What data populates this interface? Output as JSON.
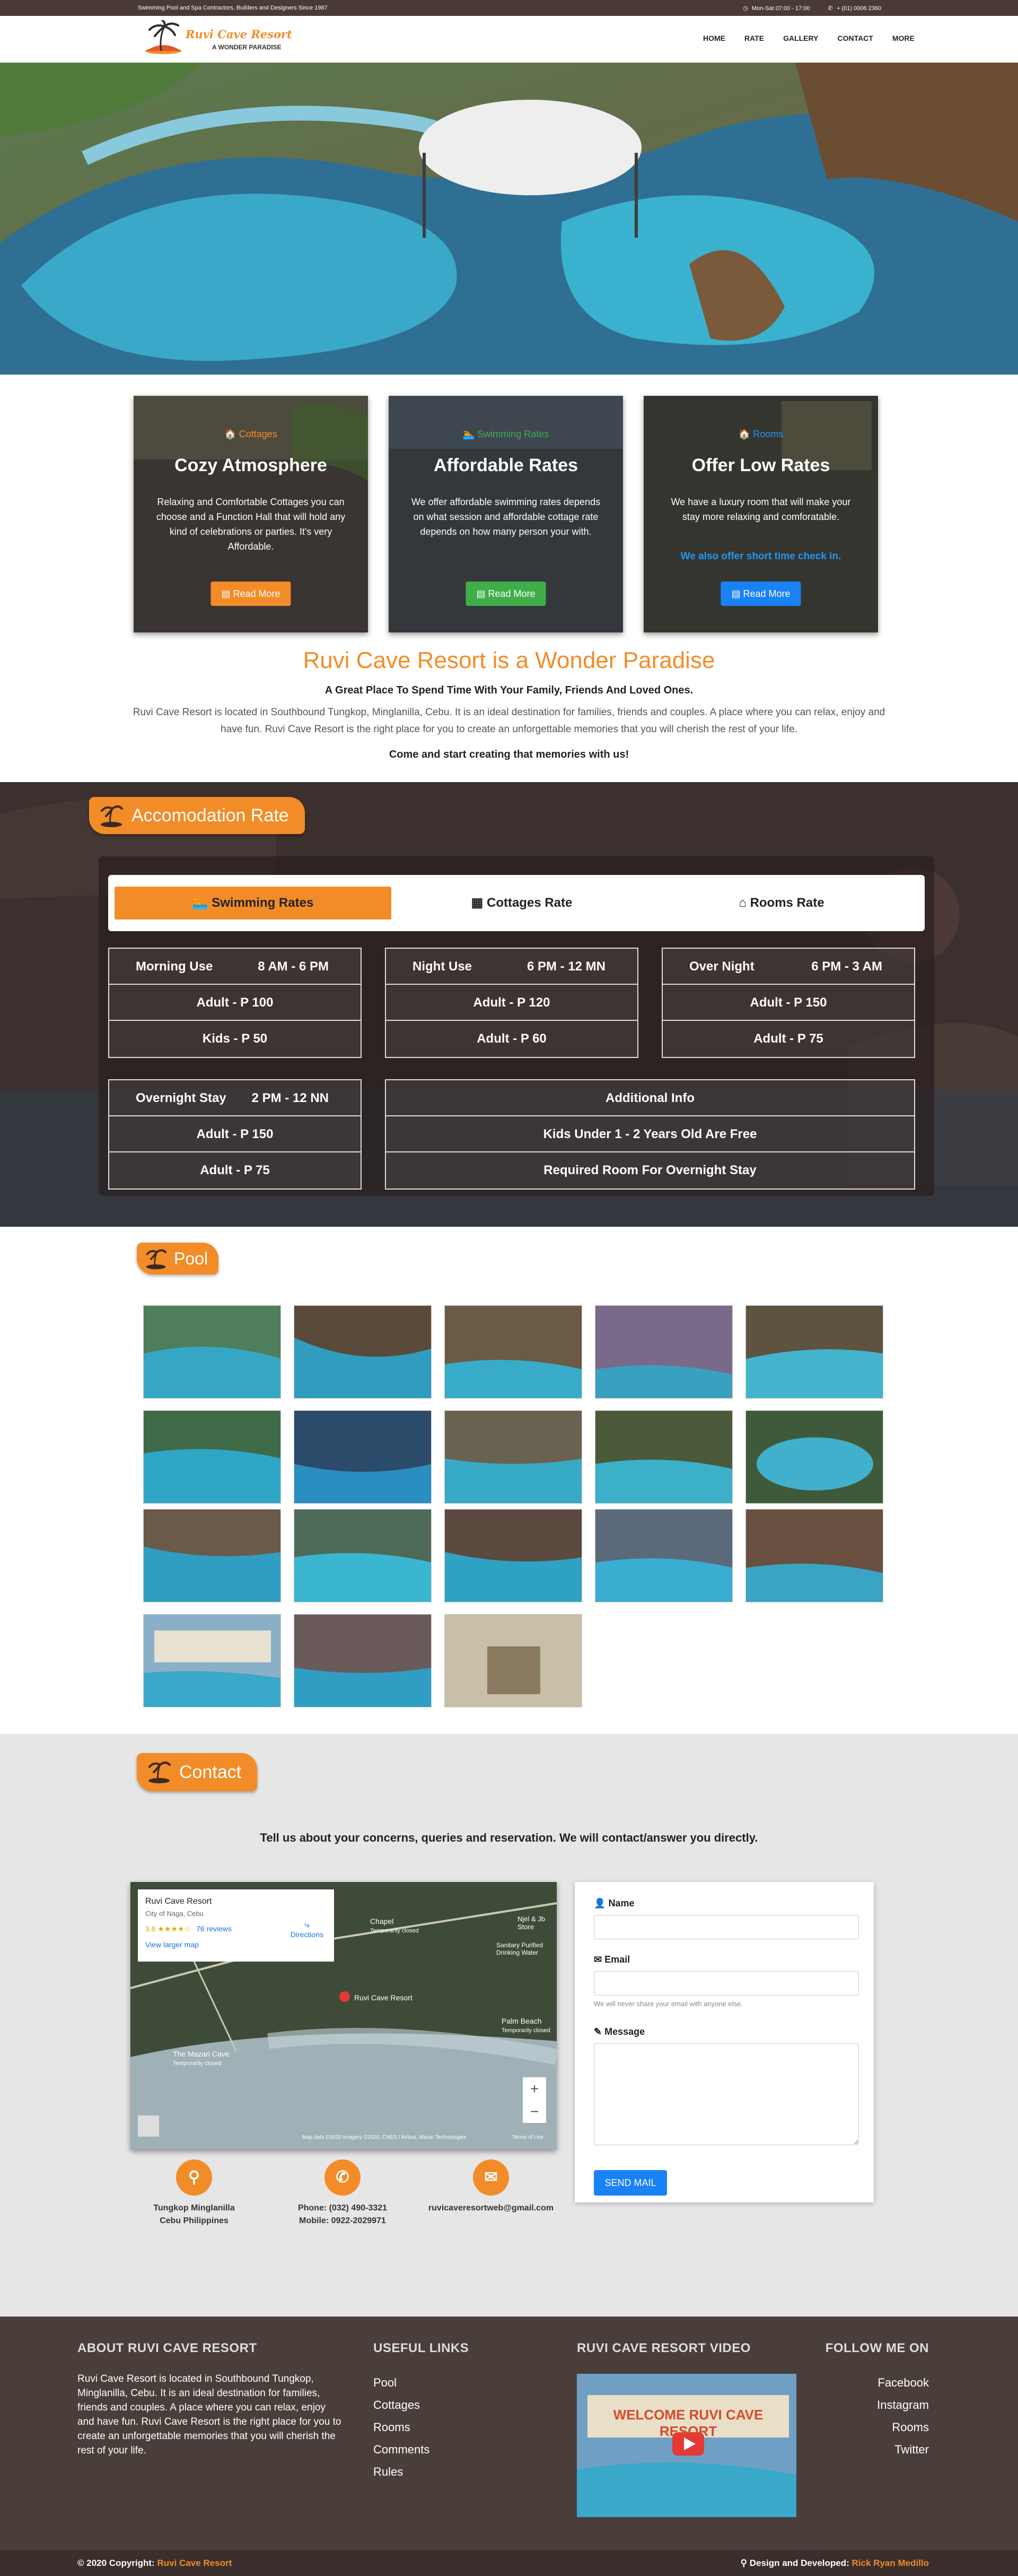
{
  "topbar": {
    "tagline": "Swimming Pool and Spa Contractors, Builders and Designers Since 1987",
    "hours": "Mon-Sat 07:00 - 17:00",
    "phone": "+ (01) 0006 2360"
  },
  "brand": {
    "name": "Ruvi Cave Resort",
    "slogan": "A WONDER PARADISE"
  },
  "nav": [
    "HOME",
    "RATE",
    "GALLERY",
    "CONTACT",
    "MORE"
  ],
  "cards": [
    {
      "category": "Cottages",
      "title": "Cozy Atmosphere",
      "text": "Relaxing and Comfortable Cottages you can choose and a Function Hall that will hold any kind of celebrations or parties. It's very Affordable.",
      "extra": "",
      "button": "Read More",
      "color": "#f28c28",
      "btn_color": "#f28c28"
    },
    {
      "category": "Swimming Rates",
      "title": "Affordable Rates",
      "text": "We offer affordable swimming rates depends on what session and affordable cottage rate depends on how many person your with.",
      "extra": "",
      "button": "Read More",
      "color": "#3fae49",
      "btn_color": "#3fae49"
    },
    {
      "category": "Rooms",
      "title": "Offer Low Rates",
      "text": "We have a luxury room that will make your stay more relaxing and comforatable.",
      "extra": "We also offer short time check in.",
      "button": "Read More",
      "color": "#2196f3",
      "btn_color": "#1a82f7"
    }
  ],
  "welcome": {
    "heading": "Ruvi Cave Resort is a Wonder Paradise",
    "subheading": "A Great Place To Spend Time With Your Family, Friends And Loved Ones.",
    "paragraph": "Ruvi Cave Resort is located in Southbound Tungkop, Minglanilla, Cebu. It is an ideal destination for families, friends and couples. A place where you can relax, enjoy and have fun. Ruvi Cave Resort is the right place for you to create an unforgettable memories that you will cherish the rest of your life.",
    "cta": "Come and start creating that memories with us!"
  },
  "accommodation": {
    "label": "Accomodation Rate",
    "tabs": [
      "Swimming Rates",
      "Cottages Rate",
      "Rooms Rate"
    ],
    "boxes": [
      {
        "title": "Morning Use",
        "time": "8 AM - 6 PM",
        "rows": [
          "Adult - P 100",
          "Kids - P 50"
        ]
      },
      {
        "title": "Night Use",
        "time": "6 PM - 12 MN",
        "rows": [
          "Adult - P 120",
          "Adult - P 60"
        ]
      },
      {
        "title": "Over Night",
        "time": "6 PM - 3 AM",
        "rows": [
          "Adult - P 150",
          "Adult - P 75"
        ]
      },
      {
        "title": "Overnight Stay",
        "time": "2 PM - 12 NN",
        "rows": [
          "Adult - P 150",
          "Adult - P 75"
        ]
      }
    ],
    "additional": {
      "title": "Additional Info",
      "rows": [
        "Kids Under 1 - 2 Years Old Are Free",
        "Required Room For Overnight Stay"
      ]
    }
  },
  "pool": {
    "label": "Pool"
  },
  "contact": {
    "label": "Contact",
    "lead": "Tell us about your concerns, queries and reservation. We will contact/answer you directly.",
    "map": {
      "place": "Ruvi Cave Resort",
      "address": "City of Naga, Cebu",
      "rating": "3.6 ★★★★☆",
      "reviews": "76 reviews",
      "larger": "View larger map",
      "directions": "Directions",
      "pin_label": "Ruvi Cave Resort",
      "poi1": "Chapel",
      "poi1_sub": "Temporarily closed",
      "poi2": "Njel & Jb Store",
      "poi3": "Sanitary Purified Drinking Water",
      "poi4": "Palm Beach",
      "poi4_sub": "Temporarily closed",
      "poi5": "The Mazari Cave",
      "poi5_sub": "Temporarily closed",
      "attribution": "Map data ©2020 Imagery ©2020, CNES / Airbus, Maxar Technologies",
      "terms": "Terms of Use"
    },
    "form": {
      "name_label": "Name",
      "email_label": "Email",
      "email_hint": "We will never share your email with anyone else.",
      "message_label": "Message",
      "send": "SEND MAIL"
    },
    "info": [
      {
        "line1": "Tungkop Minglanilla",
        "line2": "Cebu Philippines"
      },
      {
        "line1": "Phone: (032) 490-3321",
        "line2": "Mobile: 0922-2029971"
      },
      {
        "line1": "ruvicaveresortweb@gmail.com",
        "line2": ""
      }
    ]
  },
  "footer": {
    "about_h": "ABOUT RUVI CAVE RESORT",
    "about_p": "Ruvi Cave Resort is located in Southbound Tungkop, Minglanilla, Cebu. It is an ideal destination for families, friends and couples. A place where you can relax, enjoy and have fun. Ruvi Cave Resort is the right place for you to create an unforgettable memories that you will cherish the rest of your life.",
    "links_h": "USEFUL LINKS",
    "links": [
      "Pool",
      "Cottages",
      "Rooms",
      "Comments",
      "Rules"
    ],
    "video_h": "RUVI CAVE RESORT VIDEO",
    "video_sign": "WELCOME RUVI CAVE RESORT",
    "follow_h": "FOLLOW ME ON",
    "follow": [
      "Facebook",
      "Instagram",
      "Rooms",
      "Twitter"
    ],
    "copyright": "© 2020 Copyright:",
    "copyright_name": "Ruvi Cave Resort",
    "credit": "Design and Developed:",
    "credit_name": "Rick Ryan Medillo"
  }
}
